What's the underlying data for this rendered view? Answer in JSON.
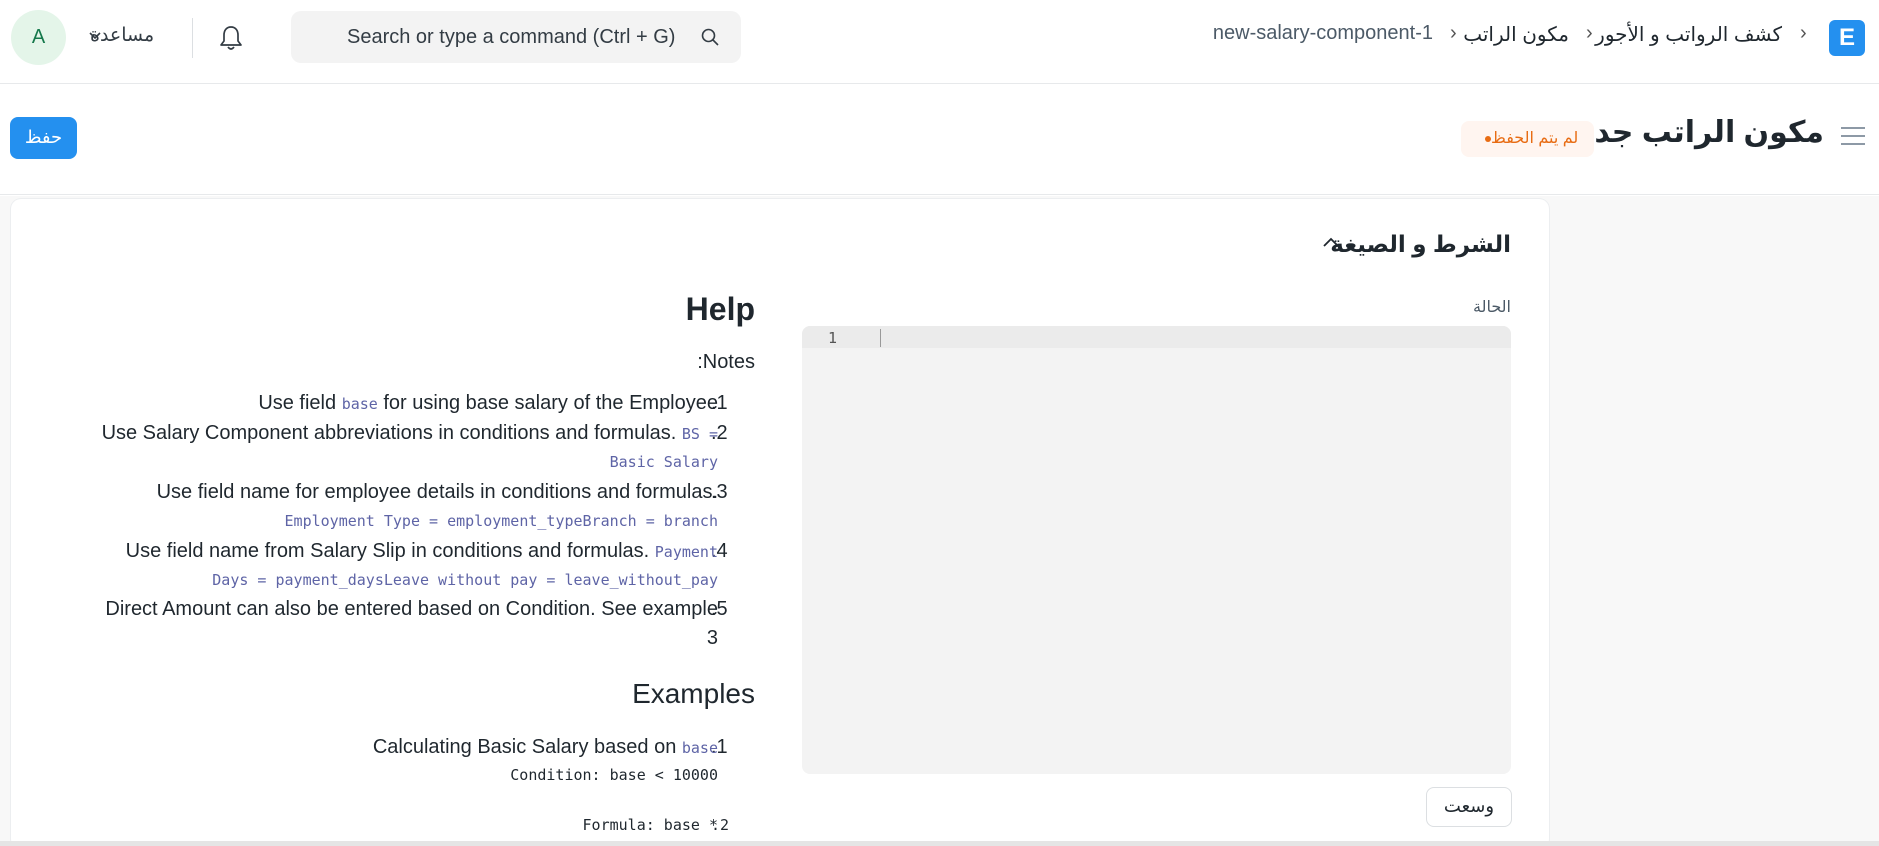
{
  "navbar": {
    "logo_letter": "E",
    "breadcrumbs": [
      "كشف الرواتب و الأجور",
      "مكون الراتب",
      "new-salary-component-1"
    ],
    "breadcrumb_separator": "›",
    "search_placeholder": "Search or type a command (Ctrl + G)",
    "help_label": "مساعدة",
    "avatar_letter": "A"
  },
  "page": {
    "title": "مكون الراتب جديد",
    "status_indicator": "لم يتم الحفظ",
    "save_label": "حفظ"
  },
  "section": {
    "title": "الشرط و الصيغة",
    "condition_label": "الحالة",
    "editor_line_number": "1",
    "expand_label": "وسعت"
  },
  "help": {
    "title": "Help",
    "notes_label": ":Notes",
    "notes": [
      {
        "num": ".1",
        "text_before": "Use field ",
        "code": "base",
        "text_after": " for using base salary of the Employee"
      },
      {
        "num": ".2",
        "text": "Use Salary Component abbreviations in conditions and formulas. ",
        "code": "BS =",
        "code_line2": "Basic Salary"
      },
      {
        "num": ".3",
        "text": "Use field name for employee details in conditions and formulas.",
        "code_line2": "Employment Type = employment_typeBranch = branch"
      },
      {
        "num": ".4",
        "text": "Use field name from Salary Slip in conditions and formulas. ",
        "code": "Payment",
        "code_line2": "Days = payment_daysLeave without pay = leave_without_pay"
      },
      {
        "num": ".5",
        "text": "Direct Amount can also be entered based on Condition. See example",
        "text_line2": "3"
      }
    ],
    "examples_title": "Examples",
    "examples": [
      {
        "num": ".1",
        "text": "Calculating Basic Salary based on ",
        "code": "base",
        "code_line2": "Condition: base < 10000"
      },
      {
        "num": ".2",
        "code": "Formula: base *"
      }
    ]
  },
  "colors": {
    "primary": "#2490ef",
    "unsaved": "#e86c13",
    "code": "#5e64a6"
  }
}
